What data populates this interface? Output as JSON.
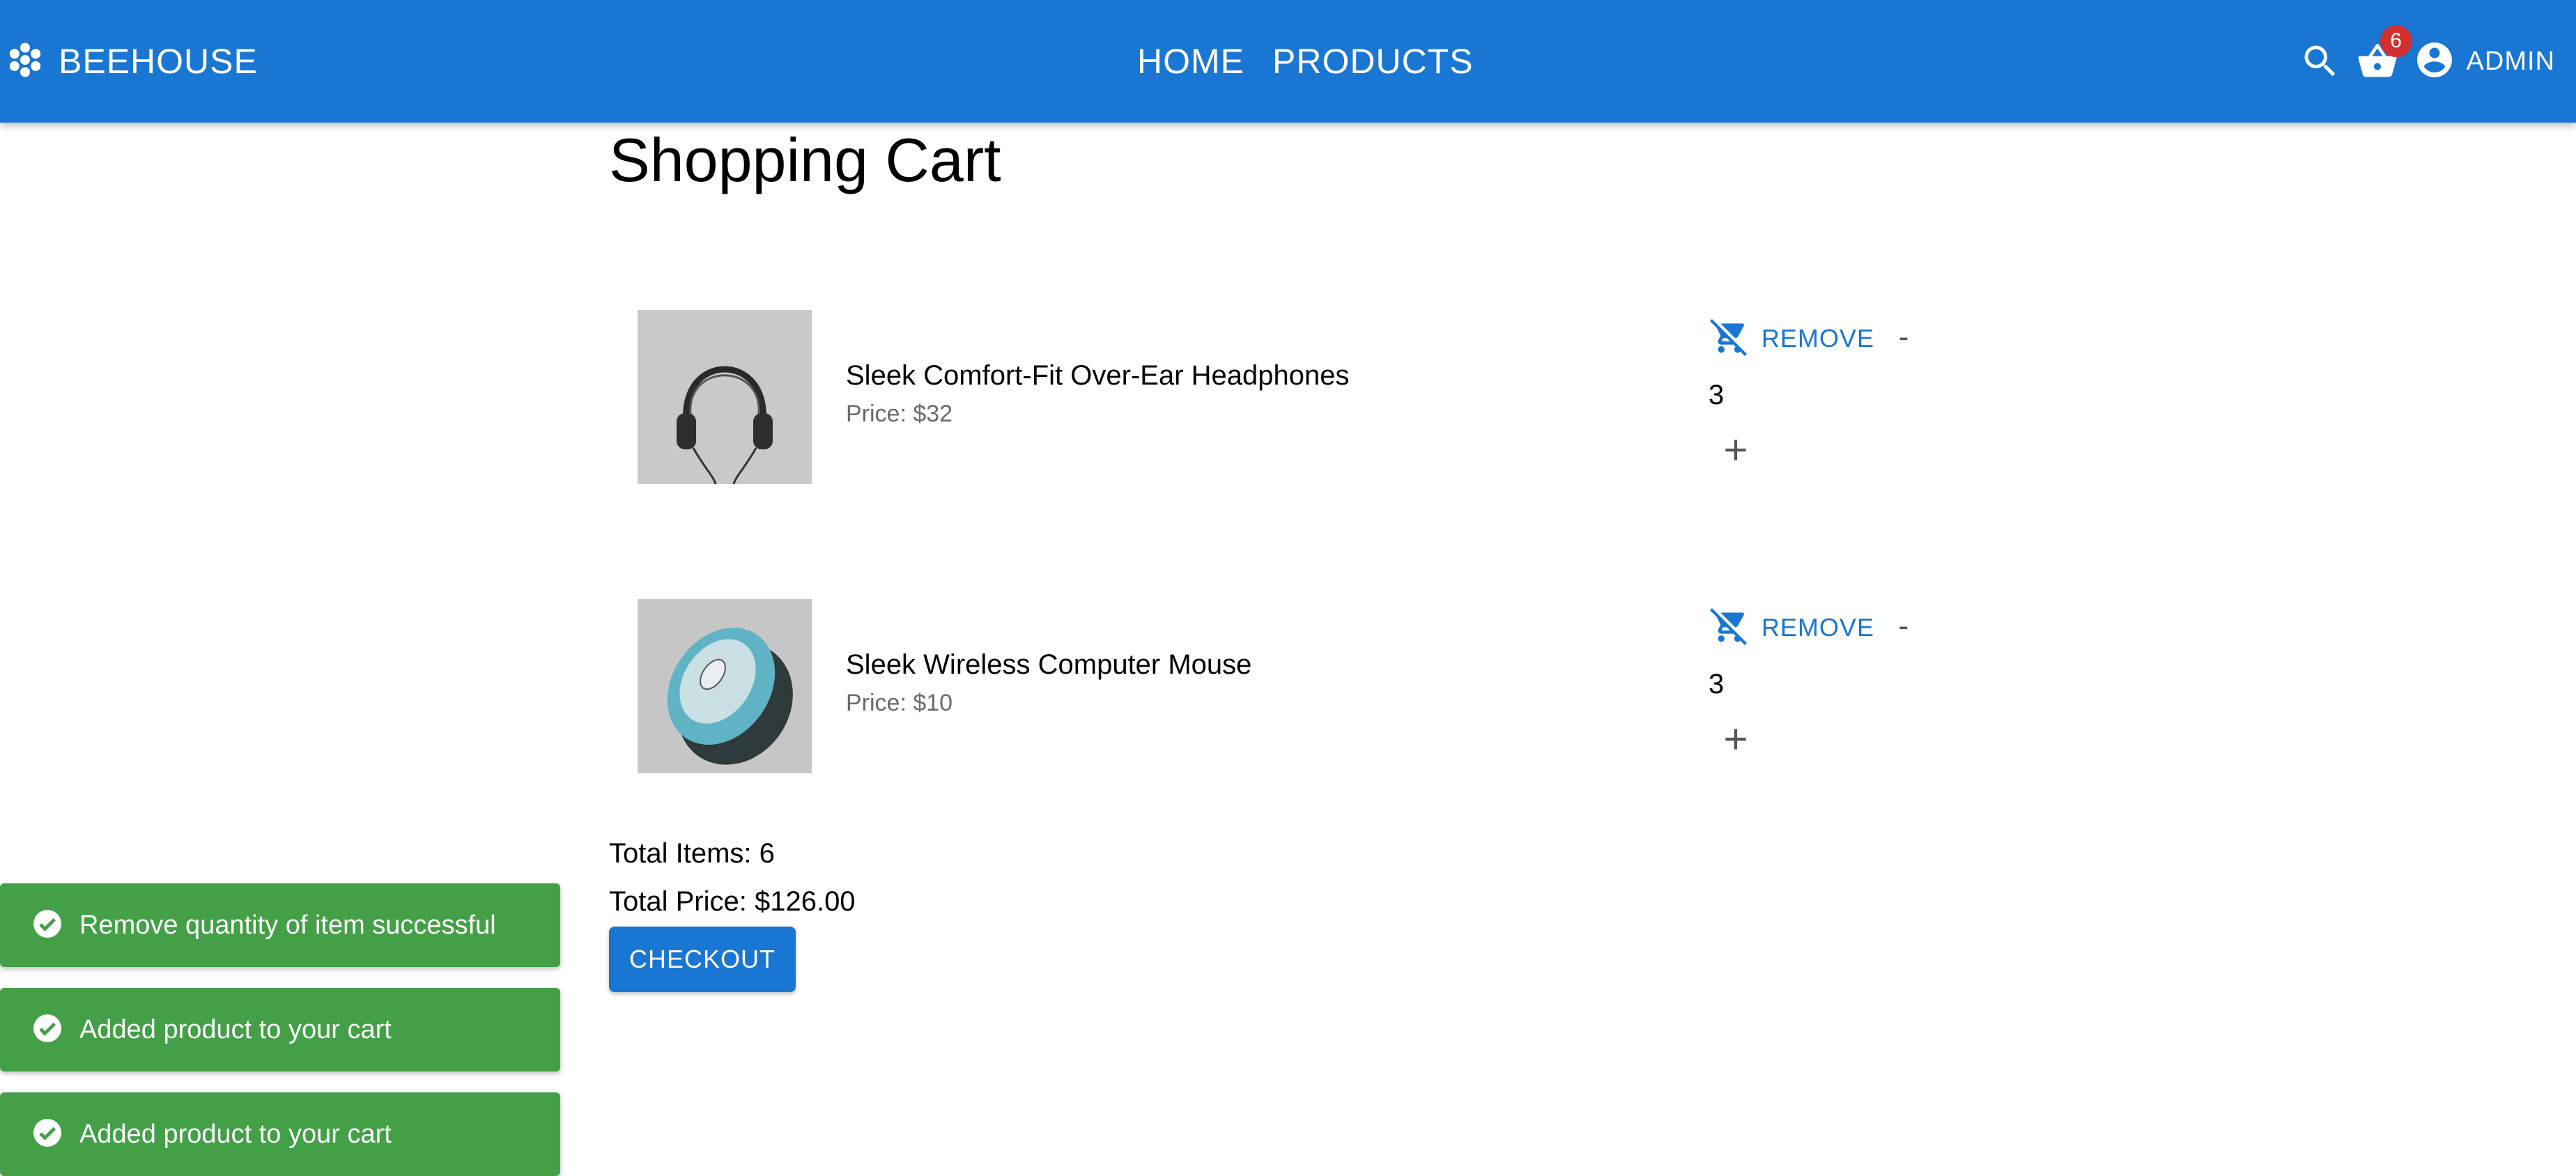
{
  "header": {
    "brand": "BEEHOUSE",
    "brand_icon": "hive-icon",
    "nav": [
      "HOME",
      "PRODUCTS"
    ],
    "cart_badge": "6",
    "account_label": "ADMIN",
    "color": "#1976d2"
  },
  "page": {
    "title": "Shopping Cart"
  },
  "cart": {
    "items": [
      {
        "name": "Sleek Comfort-Fit Over-Ear Headphones",
        "price": "Price: $32",
        "quantity": "3",
        "remove_label": "REMOVE",
        "minus_label": "-",
        "image": "headphones-image"
      },
      {
        "name": "Sleek Wireless Computer Mouse",
        "price": "Price: $10",
        "quantity": "3",
        "remove_label": "REMOVE",
        "minus_label": "-",
        "image": "mouse-image"
      }
    ],
    "total_items": "Total Items: 6",
    "total_price": "Total Price: $126.00",
    "checkout_label": "CHECKOUT"
  },
  "notifications": [
    "Remove quantity of item successful",
    "Added product to your cart",
    "Added product to your cart"
  ],
  "colors": {
    "primary": "#1976d2",
    "success": "#43a047",
    "badge": "#d32f2f"
  }
}
